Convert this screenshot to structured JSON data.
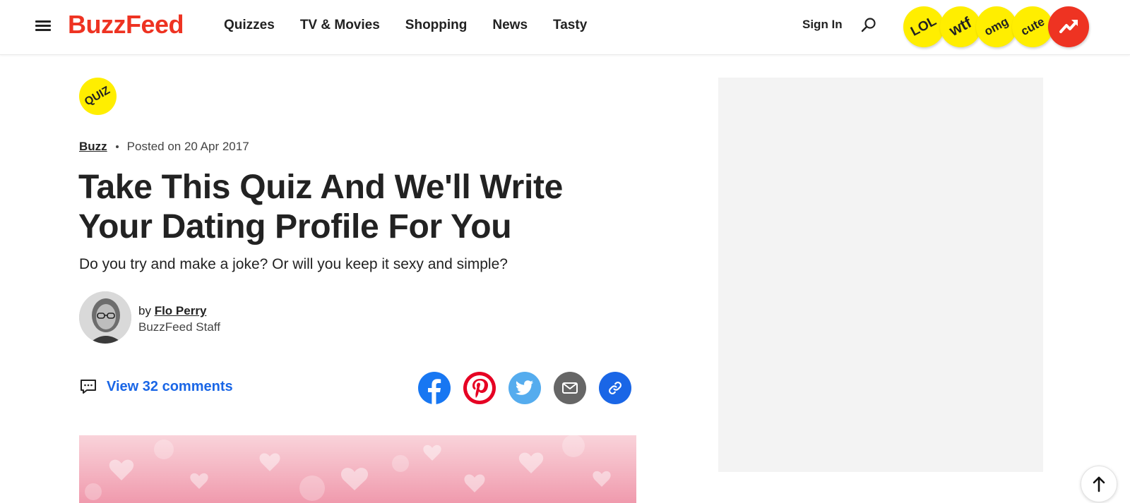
{
  "header": {
    "logo": "BuzzFeed",
    "nav": [
      "Quizzes",
      "TV & Movies",
      "Shopping",
      "News",
      "Tasty"
    ],
    "sign_in": "Sign In",
    "badges": [
      "LOL",
      "wtf",
      "omg",
      "cute"
    ],
    "trending_icon": "trending-arrow-icon"
  },
  "article": {
    "badge": "QUIZ",
    "category": "Buzz",
    "posted": "Posted on 20 Apr 2017",
    "title": "Take This Quiz And We'll Write Your Dating Profile For You",
    "subtitle": "Do you try and make a joke? Or will you keep it sexy and simple?",
    "author": {
      "by": "by",
      "name": "Flo Perry",
      "role": "BuzzFeed Staff"
    },
    "comments": "View 32 comments",
    "share_icons": [
      "facebook-icon",
      "pinterest-icon",
      "twitter-icon",
      "email-icon",
      "link-icon"
    ]
  },
  "colors": {
    "brand": "#ee3322",
    "badge_yellow": "#ffee00",
    "link_blue": "#1a66e6",
    "facebook": "#1877f2",
    "pinterest": "#e60023",
    "twitter": "#55acee",
    "email": "#666666",
    "copy_link": "#1a66e6",
    "ad_background": "#f3f3f3"
  }
}
